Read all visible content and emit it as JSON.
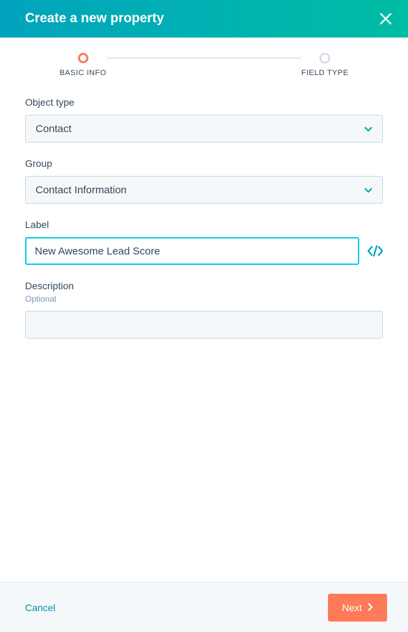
{
  "header": {
    "title": "Create a new property"
  },
  "stepper": {
    "steps": [
      {
        "label": "BASIC INFO",
        "active": true
      },
      {
        "label": "FIELD TYPE",
        "active": false
      }
    ]
  },
  "form": {
    "object_type": {
      "label": "Object type",
      "value": "Contact"
    },
    "group": {
      "label": "Group",
      "value": "Contact Information"
    },
    "label_field": {
      "label": "Label",
      "value": "New Awesome Lead Score"
    },
    "description": {
      "label": "Description",
      "sublabel": "Optional",
      "value": ""
    }
  },
  "footer": {
    "cancel_label": "Cancel",
    "next_label": "Next"
  }
}
